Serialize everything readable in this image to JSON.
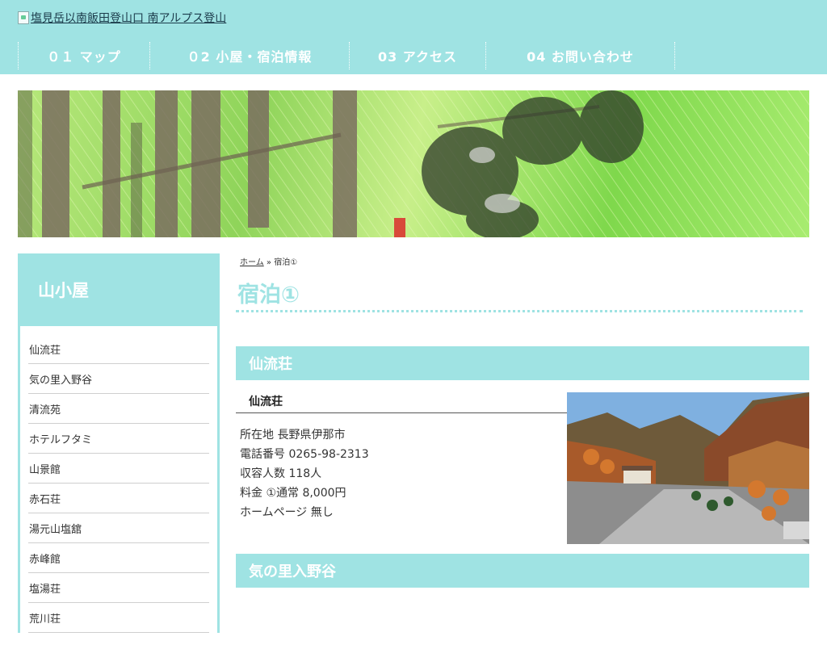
{
  "header": {
    "logo_alt": "塩見岳以南飯田登山口 南アルプス登山",
    "nav": [
      {
        "label": "０１ マップ"
      },
      {
        "label": "０2 小屋・宿泊情報"
      },
      {
        "label": "03 アクセス"
      },
      {
        "label": "04 お問い合わせ"
      }
    ]
  },
  "sidebar": {
    "title": "山小屋",
    "items": [
      {
        "label": "仙流荘"
      },
      {
        "label": "気の里入野谷"
      },
      {
        "label": "清流苑"
      },
      {
        "label": "ホテルフタミ"
      },
      {
        "label": "山景館"
      },
      {
        "label": "赤石荘"
      },
      {
        "label": "湯元山塩舘"
      },
      {
        "label": "赤峰館"
      },
      {
        "label": "塩湯荘"
      },
      {
        "label": "荒川荘"
      }
    ]
  },
  "breadcrumb": {
    "home": "ホーム",
    "sep": "»",
    "current": "宿泊①"
  },
  "page_title": "宿泊①",
  "sections": [
    {
      "heading": "仙流荘",
      "name": "仙流荘",
      "info": [
        "所在地 長野県伊那市",
        "電話番号 0265-98-2313",
        "収容人数 118人",
        "料金 ①通常 8,000円",
        "ホームページ 無し"
      ]
    },
    {
      "heading": "気の里入野谷"
    }
  ],
  "colors": {
    "accent": "#9fe3e3",
    "text": "#333333"
  }
}
